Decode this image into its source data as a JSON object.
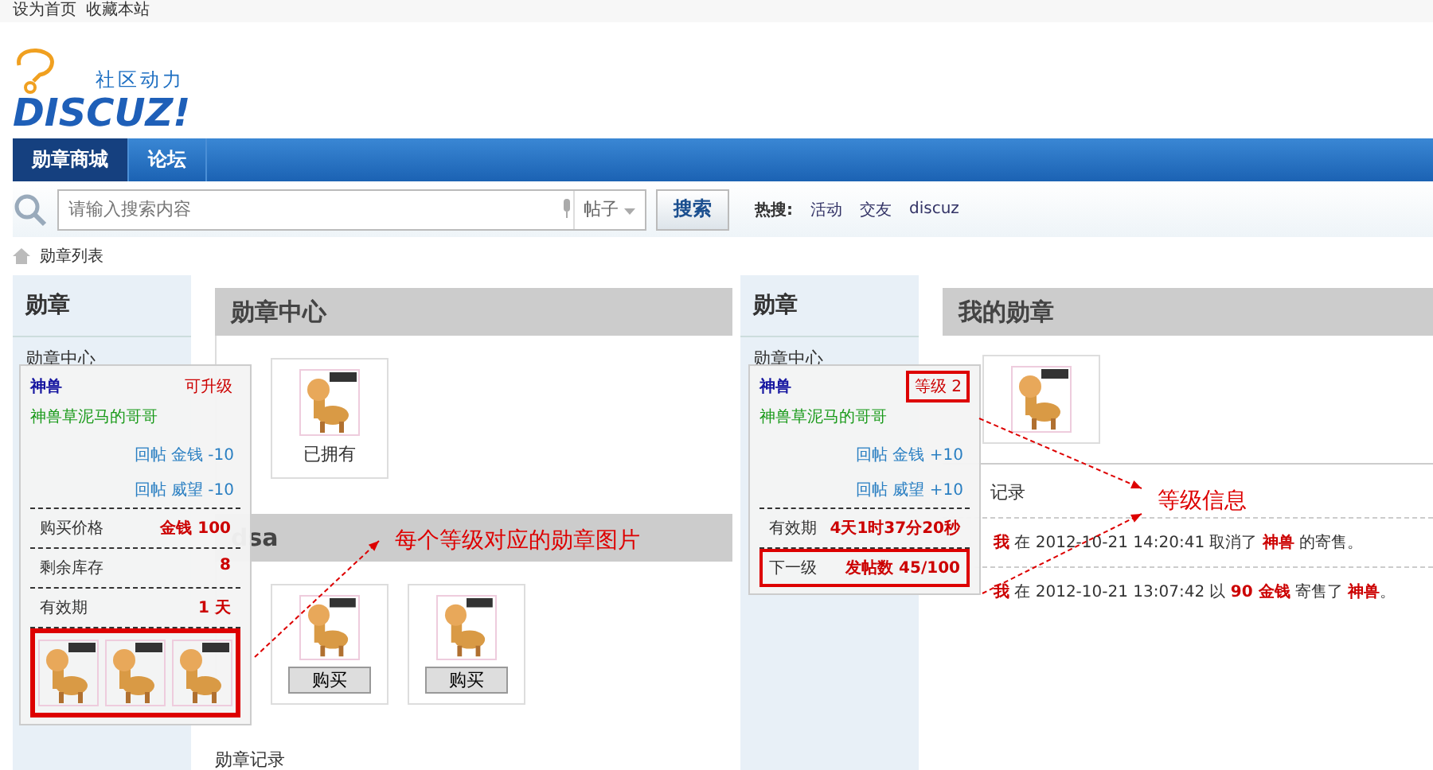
{
  "topbar": {
    "links": [
      "设为首页",
      "收藏本站"
    ]
  },
  "logo": {
    "tagline": "社区动力",
    "name": "DISCUZ!"
  },
  "nav": [
    {
      "label": "勋章商城",
      "selected": true
    },
    {
      "label": "论坛",
      "selected": false
    }
  ],
  "search": {
    "placeholder": "请输入搜索内容",
    "scope": "帖子",
    "button": "搜索",
    "hot_label": "热搜:",
    "hot": [
      "活动",
      "交友",
      "discuz"
    ]
  },
  "breadcrumb": [
    "勋章列表"
  ],
  "left_panel": {
    "sidebar": {
      "title": "勋章",
      "items": [
        "勋章中心"
      ]
    },
    "sections": [
      {
        "title": "勋章中心",
        "cards": [
          {
            "kind": "caption",
            "text": "已拥有"
          }
        ]
      },
      {
        "title": "dsa",
        "cards": [
          {
            "kind": "button",
            "text": "购买"
          },
          {
            "kind": "button",
            "text": "购买"
          }
        ]
      }
    ],
    "footer": "勋章记录",
    "popup": {
      "name": "神兽",
      "status": "可升级",
      "description": "神兽草泥马的哥哥",
      "rewards": [
        "回帖 金钱 -10",
        "回帖 威望 -10"
      ],
      "rows": [
        {
          "label": "购买价格",
          "value": "金钱 100",
          "highlighted": false
        },
        {
          "label": "剩余库存",
          "value": "8",
          "highlighted": false
        },
        {
          "label": "有效期",
          "value": "1 天",
          "highlighted": false
        }
      ],
      "level_images": [
        {
          "kind": "medal"
        },
        {
          "kind": "medal"
        },
        {
          "kind": "medal"
        }
      ],
      "images_highlighted": true,
      "status_highlighted": false
    },
    "annotation": "每个等级对应的勋章图片"
  },
  "right_panel": {
    "sidebar": {
      "title": "勋章",
      "items": [
        "勋章中心"
      ]
    },
    "section_title": "我的勋章",
    "log_title": "记录",
    "log": [
      "**我** 在 2012-10-21 14:20:41 取消了 **神兽** 的寄售。",
      "**我** 在 2012-10-21 13:07:42 以 **90 金钱** 寄售了 **神兽**。"
    ],
    "popup": {
      "name": "神兽",
      "status": "等级 2",
      "description": "神兽草泥马的哥哥",
      "rewards": [
        "回帖 金钱 +10",
        "回帖 威望 +10"
      ],
      "rows": [
        {
          "label": "有效期",
          "value": "4天1时37分20秒",
          "highlighted": false
        },
        {
          "label": "下一级",
          "value": "发帖数 45/100",
          "highlighted": true
        }
      ],
      "status_highlighted": true
    },
    "annotation": "等级信息"
  }
}
